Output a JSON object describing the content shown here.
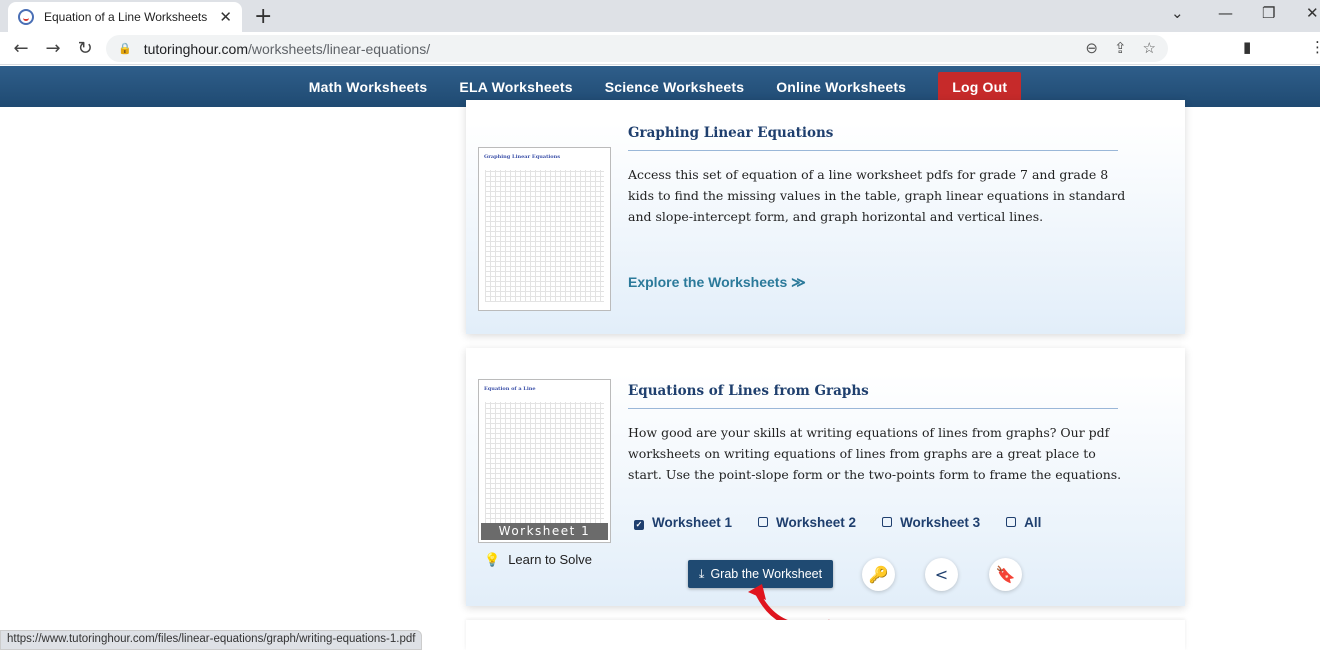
{
  "browser": {
    "tab_title": "Equation of a Line Worksheets",
    "url_host": "tutoringhour.com",
    "url_path": "/worksheets/linear-equations/",
    "status_url": "https://www.tutoringhour.com/files/linear-equations/graph/writing-equations-1.pdf"
  },
  "nav": {
    "items": [
      "Math Worksheets",
      "ELA Worksheets",
      "Science Worksheets",
      "Online Worksheets"
    ],
    "logout": "Log Out"
  },
  "cards": [
    {
      "thumb_title": "Graphing Linear Equations",
      "title": "Graphing Linear Equations",
      "description": "Access this set of equation of a line worksheet pdfs for grade 7 and grade 8 kids to find the missing values in the table, graph linear equations in standard and slope-intercept form, and graph horizontal and vertical lines.",
      "link": "Explore the Worksheets ≫"
    },
    {
      "thumb_title": "Equation of a Line",
      "thumb_label": "Worksheet 1",
      "title": "Equations of Lines from Graphs",
      "description": "How good are your skills at writing equations of lines from graphs? Our pdf worksheets on writing equations of lines from graphs are a great place to start. Use the point-slope form or the two-points form to frame the equations.",
      "options": [
        {
          "label": "Worksheet 1",
          "checked": true
        },
        {
          "label": "Worksheet 2",
          "checked": false
        },
        {
          "label": "Worksheet 3",
          "checked": false
        },
        {
          "label": "All",
          "checked": false
        }
      ],
      "learn": "Learn to Solve",
      "grab": "Grab the Worksheet"
    }
  ],
  "colors": {
    "nav": "#1f4a72",
    "logout": "#c62a2a",
    "title": "#1f3f6e",
    "link": "#2b7a9a",
    "arrow": "#e0141e"
  }
}
